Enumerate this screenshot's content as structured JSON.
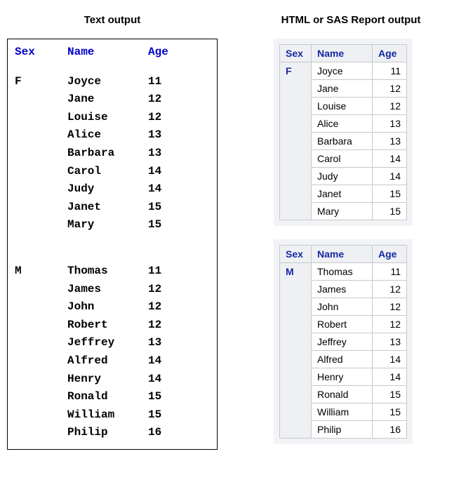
{
  "left": {
    "title": "Text output",
    "headers": {
      "sex": "Sex",
      "name": "Name",
      "age": "Age"
    },
    "groups": [
      {
        "sex": "F",
        "rows": [
          {
            "name": "Joyce",
            "age": "11"
          },
          {
            "name": "Jane",
            "age": "12"
          },
          {
            "name": "Louise",
            "age": "12"
          },
          {
            "name": "Alice",
            "age": "13"
          },
          {
            "name": "Barbara",
            "age": "13"
          },
          {
            "name": "Carol",
            "age": "14"
          },
          {
            "name": "Judy",
            "age": "14"
          },
          {
            "name": "Janet",
            "age": "15"
          },
          {
            "name": "Mary",
            "age": "15"
          }
        ]
      },
      {
        "sex": "M",
        "rows": [
          {
            "name": "Thomas",
            "age": "11"
          },
          {
            "name": "James",
            "age": "12"
          },
          {
            "name": "John",
            "age": "12"
          },
          {
            "name": "Robert",
            "age": "12"
          },
          {
            "name": "Jeffrey",
            "age": "13"
          },
          {
            "name": "Alfred",
            "age": "14"
          },
          {
            "name": "Henry",
            "age": "14"
          },
          {
            "name": "Ronald",
            "age": "15"
          },
          {
            "name": "William",
            "age": "15"
          },
          {
            "name": "Philip",
            "age": "16"
          }
        ]
      }
    ]
  },
  "right": {
    "title": "HTML or SAS Report output",
    "headers": {
      "sex": "Sex",
      "name": "Name",
      "age": "Age"
    },
    "tables": [
      {
        "sex": "F",
        "rows": [
          {
            "name": "Joyce",
            "age": "11"
          },
          {
            "name": "Jane",
            "age": "12"
          },
          {
            "name": "Louise",
            "age": "12"
          },
          {
            "name": "Alice",
            "age": "13"
          },
          {
            "name": "Barbara",
            "age": "13"
          },
          {
            "name": "Carol",
            "age": "14"
          },
          {
            "name": "Judy",
            "age": "14"
          },
          {
            "name": "Janet",
            "age": "15"
          },
          {
            "name": "Mary",
            "age": "15"
          }
        ]
      },
      {
        "sex": "M",
        "rows": [
          {
            "name": "Thomas",
            "age": "11"
          },
          {
            "name": "James",
            "age": "12"
          },
          {
            "name": "John",
            "age": "12"
          },
          {
            "name": "Robert",
            "age": "12"
          },
          {
            "name": "Jeffrey",
            "age": "13"
          },
          {
            "name": "Alfred",
            "age": "14"
          },
          {
            "name": "Henry",
            "age": "14"
          },
          {
            "name": "Ronald",
            "age": "15"
          },
          {
            "name": "William",
            "age": "15"
          },
          {
            "name": "Philip",
            "age": "16"
          }
        ]
      }
    ]
  }
}
